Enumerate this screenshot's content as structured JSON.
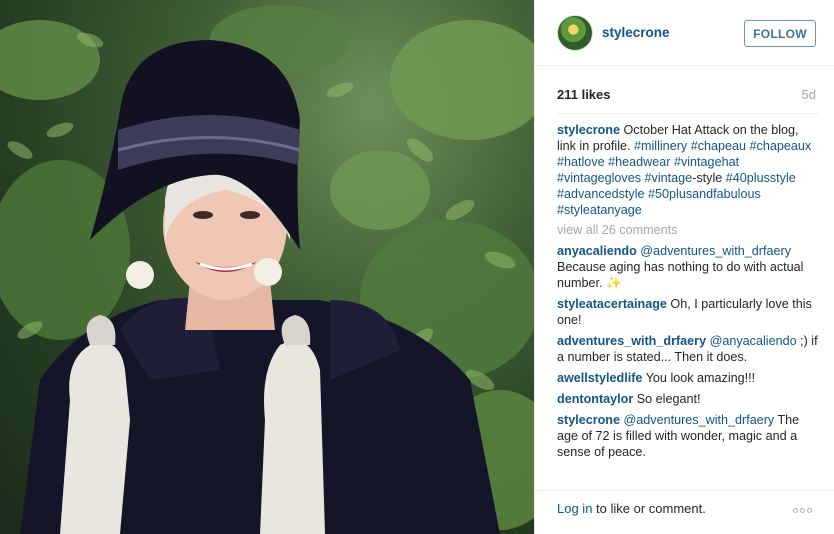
{
  "post": {
    "author": "stylecrone",
    "follow_label": "FOLLOW",
    "likes": "211 likes",
    "age": "5d",
    "caption": {
      "user": "stylecrone",
      "text": "October Hat Attack on the blog, link in profile.",
      "hashtags": [
        "#millinery",
        "#chapeau",
        "#chapeaux",
        "#hatlove",
        "#headwear",
        "#vintagehat",
        "#vintagegloves",
        "#vintage",
        "#40plusstyle",
        "#advancedstyle",
        "#50plusandfabulous",
        "#styleatanyage"
      ],
      "suffix_after_vintage": "-style"
    },
    "view_all": "view all 26 comments",
    "comments": [
      {
        "user": "anyacaliendo",
        "mention": "@adventures_with_drfaery",
        "text": "Because aging has nothing to do with actual number. ✨"
      },
      {
        "user": "styleatacertainage",
        "mention": "",
        "text": "Oh, I particularly love this one!"
      },
      {
        "user": "adventures_with_drfaery",
        "mention": "@anyacaliendo",
        "text": ";) if a number is stated... Then it does."
      },
      {
        "user": "awellstyledlife",
        "mention": "",
        "text": "You look amazing!!!"
      },
      {
        "user": "dentontaylor",
        "mention": "",
        "text": "So elegant!"
      },
      {
        "user": "stylecrone",
        "mention": "@adventures_with_drfaery",
        "text": "The age of 72 is filled with wonder, magic and a sense of peace."
      }
    ],
    "login_link": "Log in",
    "login_rest": "to like or comment.",
    "colors": {
      "link": "#125688",
      "follow_border": "#6f97b6",
      "muted": "#a5a7aa"
    }
  }
}
